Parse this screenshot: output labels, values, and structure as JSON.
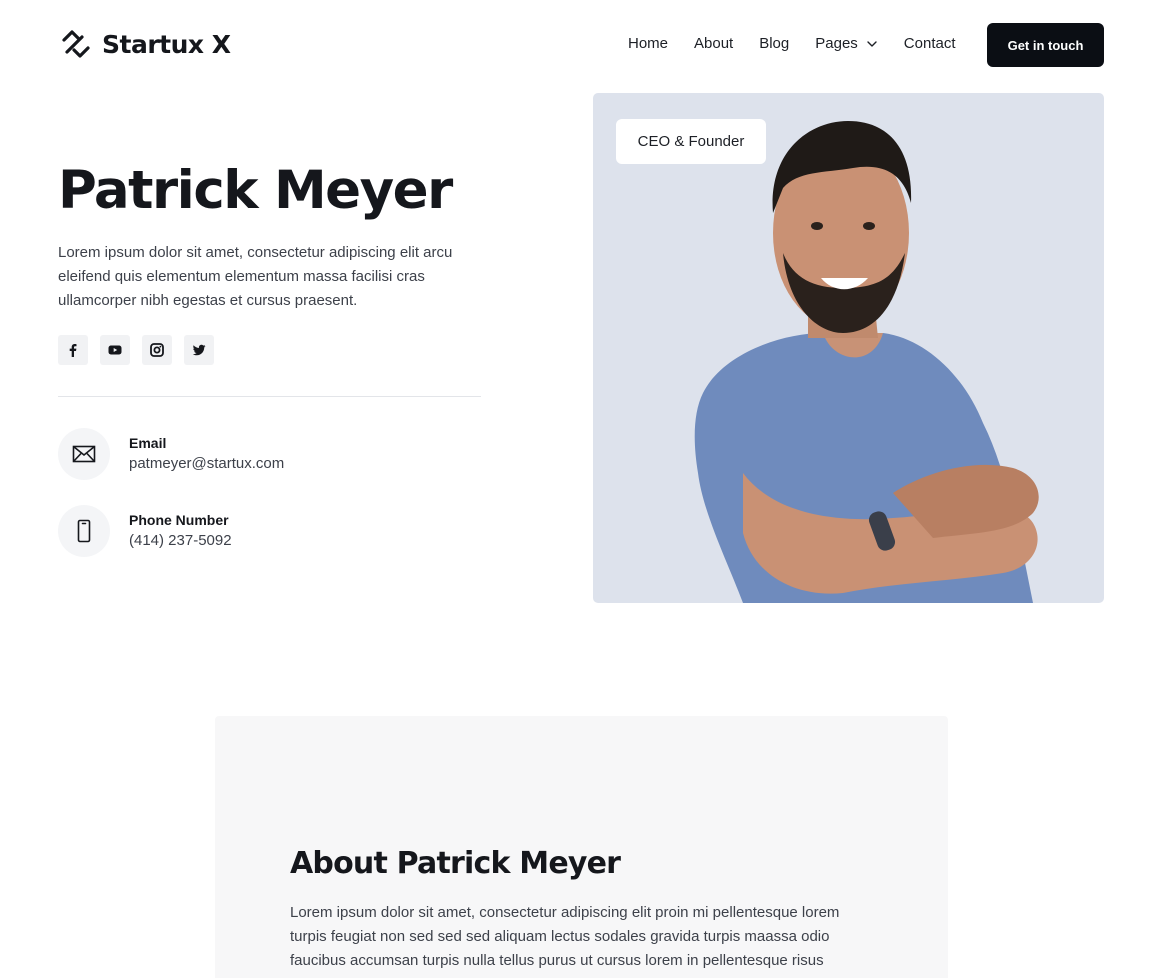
{
  "brand": {
    "name": "Startux X"
  },
  "nav": {
    "items": [
      "Home",
      "About",
      "Blog",
      "Pages",
      "Contact"
    ],
    "cta_label": "Get in touch"
  },
  "hero": {
    "name": "Patrick Meyer",
    "bio": "Lorem ipsum dolor sit amet, consectetur adipiscing elit arcu eleifend quis elementum elementum massa facilisi cras ullamcorper nibh egestas et cursus praesent.",
    "socials": [
      "facebook-icon",
      "youtube-icon",
      "instagram-icon",
      "twitter-icon"
    ],
    "role_badge": "CEO & Founder"
  },
  "contact": {
    "email_label": "Email",
    "email_value": "patmeyer@startux.com",
    "phone_label": "Phone Number",
    "phone_value": "(414) 237-5092"
  },
  "about": {
    "title": "About Patrick Meyer",
    "text": "Lorem ipsum dolor sit amet, consectetur adipiscing elit proin mi pellentesque  lorem turpis feugiat non sed sed sed aliquam lectus sodales gravida turpis maassa odio faucibus accumsan turpis nulla tellus purus ut   cursus lorem  in pellentesque risus"
  },
  "colors": {
    "accent": "#0b0e14",
    "photo_bg": "#dde2ec",
    "section_bg": "#f7f7f8"
  }
}
